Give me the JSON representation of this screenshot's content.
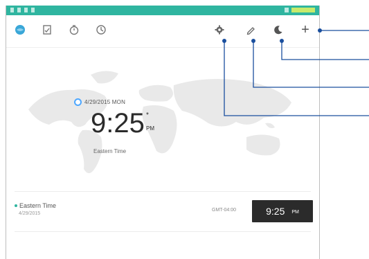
{
  "toolbar": {
    "tabs": [
      {
        "icon": "world-clock-icon",
        "active": true
      },
      {
        "icon": "alarm-list-icon",
        "active": false
      },
      {
        "icon": "stopwatch-icon",
        "active": false
      },
      {
        "icon": "timer-icon",
        "active": false
      }
    ],
    "actions": [
      {
        "icon": "settings-icon"
      },
      {
        "icon": "edit-pencil-icon"
      },
      {
        "icon": "night-mode-moon-icon"
      },
      {
        "icon": "add-plus-icon",
        "glyph": "+"
      }
    ]
  },
  "clock": {
    "date": "4/29/2015 MON",
    "time": "9:25",
    "seconds_mark": "*",
    "ampm": "PM",
    "zone": "Eastern Time"
  },
  "list": [
    {
      "city": "Eastern Time",
      "date": "4/29/2015",
      "gmt": "GMT-04:00",
      "time": "9:25",
      "ampm": "PM"
    }
  ],
  "colors": {
    "status_bar": "#2fb5a0",
    "accent": "#3aa7d8",
    "callout_line": "#1a4f9e",
    "time_box": "#2b2b2b"
  }
}
